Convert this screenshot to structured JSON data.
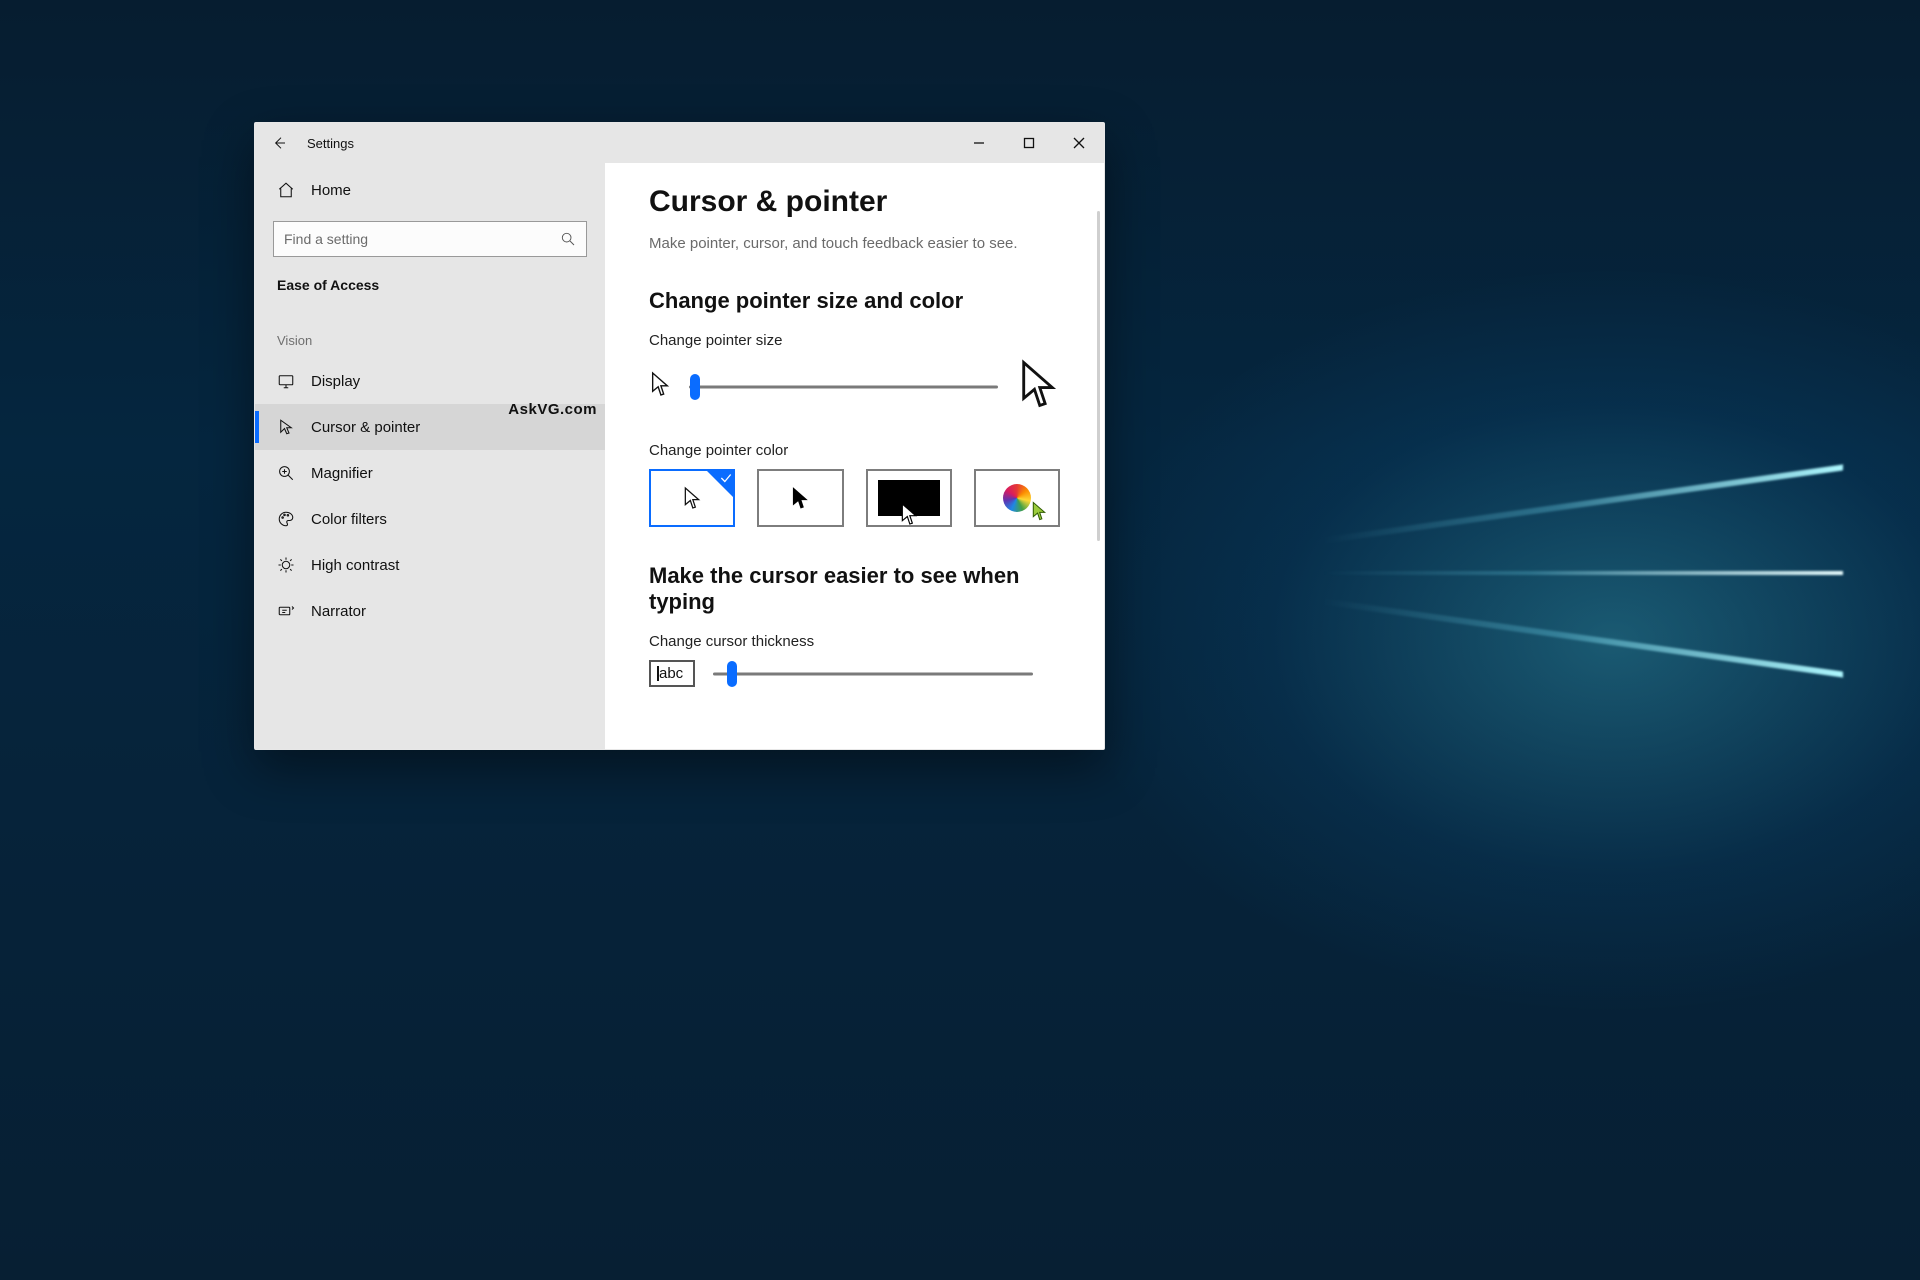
{
  "app_title": "Settings",
  "home_label": "Home",
  "search": {
    "placeholder": "Find a setting"
  },
  "section": "Ease of Access",
  "group_label": "Vision",
  "watermark": "AskVG.com",
  "nav": {
    "items": [
      {
        "label": "Display"
      },
      {
        "label": "Cursor & pointer",
        "active": true
      },
      {
        "label": "Magnifier"
      },
      {
        "label": "Color filters"
      },
      {
        "label": "High contrast"
      },
      {
        "label": "Narrator"
      }
    ]
  },
  "page": {
    "title": "Cursor & pointer",
    "subtitle": "Make pointer, cursor, and touch feedback easier to see.",
    "section1": "Change pointer size and color",
    "pointer_size_label": "Change pointer size",
    "pointer_size_value": 2,
    "pointer_color_label": "Change pointer color",
    "color_options": [
      "white",
      "black-on-white",
      "inverted",
      "custom"
    ],
    "color_selected": 0,
    "section2": "Make the cursor easier to see when typing",
    "thickness_label": "Change cursor thickness",
    "thickness_sample": "abc",
    "thickness_value": 6
  }
}
